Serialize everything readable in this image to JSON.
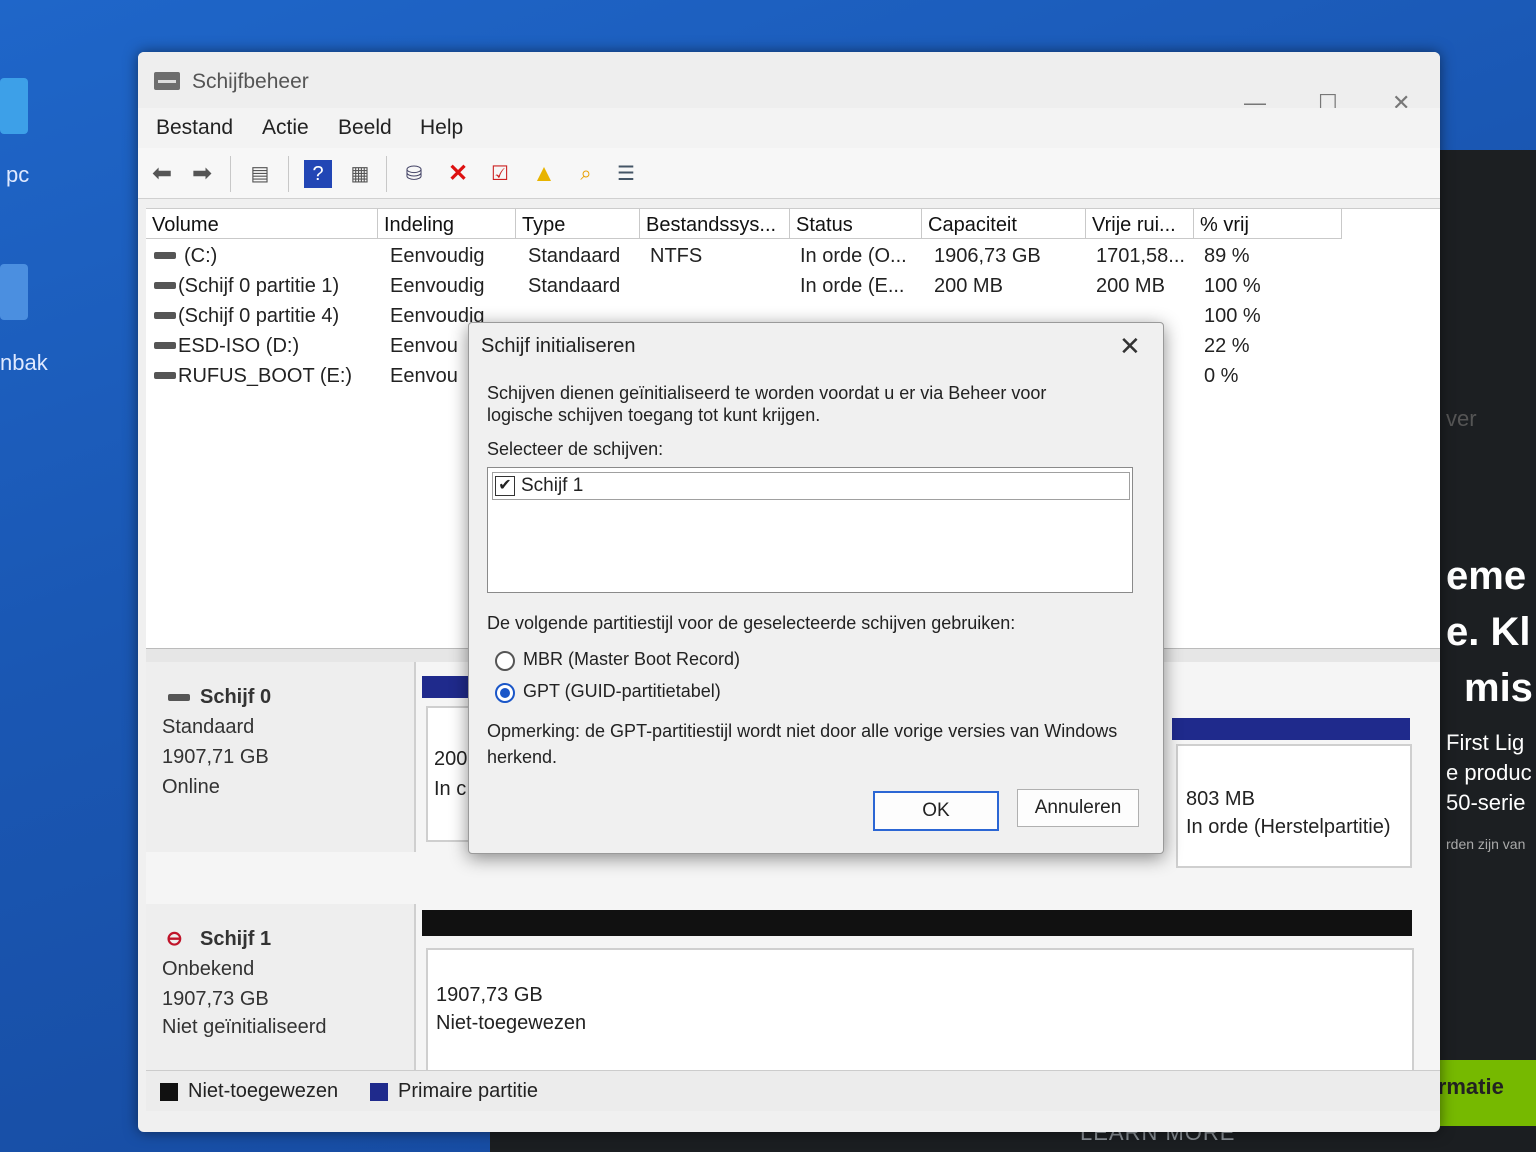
{
  "desktop": {
    "label_pc": "pc",
    "label_bak": "nbak"
  },
  "background_ad": {
    "lines": [
      "eme",
      "e. Kl",
      "mis",
      "First Lig",
      "e produc",
      "50-serie",
      "rden zijn van"
    ],
    "fragment_ver": "ver",
    "meer_informatie": "Meer informatie",
    "learn_more": "LEARN MORE",
    "accent_color": "#76b900"
  },
  "window": {
    "title": "Schijfbeheer",
    "controls": {
      "minimize": "—",
      "maximize": "☐",
      "close": "✕"
    },
    "menu": [
      "Bestand",
      "Actie",
      "Beeld",
      "Help"
    ],
    "toolbar_icons": [
      "back-arrow-icon",
      "forward-arrow-icon",
      "console-tree-icon",
      "help-icon",
      "properties-icon",
      "connect-drive-icon",
      "delete-icon",
      "check-icon",
      "folder-up-icon",
      "search-folder-icon",
      "list-icon"
    ]
  },
  "volume_list": {
    "columns": [
      "Volume",
      "Indeling",
      "Type",
      "Bestandssys...",
      "Status",
      "Capaciteit",
      "Vrije rui...",
      "% vrij"
    ],
    "rows": [
      {
        "volume": "(C:)",
        "indeling": "Eenvoudig",
        "type": "Standaard",
        "fs": "NTFS",
        "status": "In orde (O...",
        "capaciteit": "1906,73 GB",
        "vrij": "1701,58...",
        "pct": "89 %"
      },
      {
        "volume": "(Schijf 0 partitie 1)",
        "indeling": "Eenvoudig",
        "type": "Standaard",
        "fs": "",
        "status": "In orde (E...",
        "capaciteit": "200 MB",
        "vrij": "200 MB",
        "pct": "100 %"
      },
      {
        "volume": "(Schijf 0 partitie 4)",
        "indeling": "Eenvoudig",
        "type": "",
        "fs": "",
        "status": "",
        "capaciteit": "",
        "vrij": "",
        "pct": "100 %"
      },
      {
        "volume": "ESD-ISO (D:)",
        "indeling": "Eenvou",
        "type": "",
        "fs": "",
        "status": "",
        "capaciteit": "",
        "vrij": "",
        "pct": "22 %"
      },
      {
        "volume": "RUFUS_BOOT (E:)",
        "indeling": "Eenvou",
        "type": "",
        "fs": "",
        "status": "",
        "capaciteit": "",
        "vrij": "",
        "pct": "0 %"
      }
    ]
  },
  "disks": [
    {
      "name": "Schijf 0",
      "type": "Standaard",
      "size": "1907,71 GB",
      "state": "Online",
      "partition_left": {
        "size": "200",
        "status": "In c"
      },
      "partition_right": {
        "size": "803 MB",
        "status": "In orde (Herstelpartitie)"
      }
    },
    {
      "name": "Schijf 1",
      "type": "Onbekend",
      "size": "1907,73 GB",
      "state": "Niet geïnitialiseerd",
      "unallocated": {
        "size": "1907,73 GB",
        "label": "Niet-toegewezen"
      }
    }
  ],
  "legend": [
    {
      "label": "Niet-toegewezen",
      "color": "#111111"
    },
    {
      "label": "Primaire partitie",
      "color": "#1f2a8c"
    }
  ],
  "dialog": {
    "title": "Schijf initialiseren",
    "intro_line1": "Schijven dienen geïnitialiseerd te worden voordat u er via Beheer voor",
    "intro_line2": "logische schijven toegang tot kunt krijgen.",
    "select_label": "Selecteer de schijven:",
    "disk_item": "Schijf 1",
    "disk_checked": true,
    "style_label": "De volgende partitiestijl voor de geselecteerde schijven gebruiken:",
    "option_mbr": "MBR (Master Boot Record)",
    "option_gpt": "GPT (GUID-partitietabel)",
    "selected_option": "GPT",
    "note_line1": "Opmerking: de GPT-partitiestijl wordt niet door alle vorige versies van Windows",
    "note_line2": "herkend.",
    "ok": "OK",
    "cancel": "Annuleren"
  }
}
